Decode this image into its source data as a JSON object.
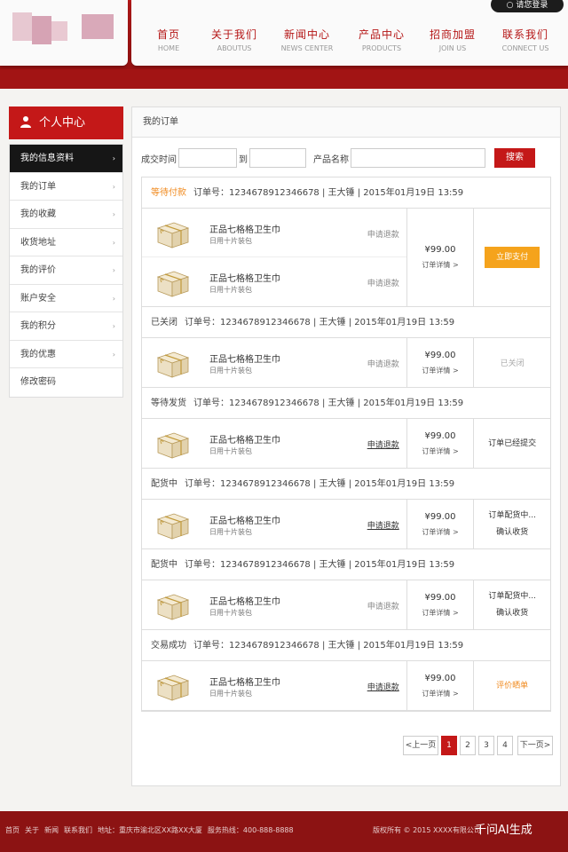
{
  "header": {
    "login_label": "○ 请您登录",
    "nav": [
      {
        "cn": "首页",
        "en": "HOME"
      },
      {
        "cn": "关于我们",
        "en": "ABOUTUS"
      },
      {
        "cn": "新闻中心",
        "en": "NEWS CENTER"
      },
      {
        "cn": "产品中心",
        "en": "PRODUCTS"
      },
      {
        "cn": "招商加盟",
        "en": "JOIN US"
      },
      {
        "cn": "联系我们",
        "en": "CONNECT US"
      }
    ]
  },
  "sidebar": {
    "title": "个人中心",
    "items": [
      {
        "label": "我的信息资料"
      },
      {
        "label": "我的订单"
      },
      {
        "label": "我的收藏"
      },
      {
        "label": "收货地址"
      },
      {
        "label": "我的评价"
      },
      {
        "label": "账户安全"
      },
      {
        "label": "我的积分"
      },
      {
        "label": "我的优惠"
      },
      {
        "label": "修改密码"
      }
    ]
  },
  "main": {
    "title": "我的订单",
    "search": {
      "date_label": "成交时间",
      "to_label": "到",
      "product_label": "产品名称",
      "button": "搜索"
    },
    "orders": [
      {
        "status": "等待付款",
        "status_orange": true,
        "info": "订单号：1234678912346678 | 王大锤 | 2015年01月19日 13:59",
        "items": [
          {
            "name": "正品七格格卫生巾",
            "spec": "日用十片装包",
            "action": "申请退款"
          },
          {
            "name": "正品七格格卫生巾",
            "spec": "日用十片装包",
            "action": "申请退款"
          }
        ],
        "price": "¥99.00",
        "detail": "订单详情 >",
        "op": {
          "type": "button",
          "text": "立即支付"
        }
      },
      {
        "status": "已关闭",
        "status_orange": false,
        "info": "订单号：1234678912346678 | 王大锤 | 2015年01月19日 13:59",
        "items": [
          {
            "name": "正品七格格卫生巾",
            "spec": "日用十片装包",
            "action": "申请退款"
          }
        ],
        "price": "¥99.00",
        "detail": "订单详情 >",
        "op": {
          "type": "muted",
          "text": "已关闭"
        }
      },
      {
        "status": "等待发货",
        "status_orange": false,
        "info": "订单号：1234678912346678 | 王大锤 | 2015年01月19日 13:59",
        "items": [
          {
            "name": "正品七格格卫生巾",
            "spec": "日用十片装包",
            "action": "申请退款"
          }
        ],
        "price": "¥99.00",
        "detail": "订单详情 >",
        "op": {
          "type": "text",
          "text": "订单已经提交"
        }
      },
      {
        "status": "配货中",
        "status_orange": false,
        "info": "订单号：1234678912346678 | 王大锤 | 2015年01月19日 13:59",
        "items": [
          {
            "name": "正品七格格卫生巾",
            "spec": "日用十片装包",
            "action": "申请退款"
          }
        ],
        "price": "¥99.00",
        "detail": "订单详情 >",
        "op": {
          "type": "two",
          "text": "订单配货中...",
          "sub": "确认收货"
        }
      },
      {
        "status": "配货中",
        "status_orange": false,
        "info": "订单号：1234678912346678 | 王大锤 | 2015年01月19日 13:59",
        "items": [
          {
            "name": "正品七格格卫生巾",
            "spec": "日用十片装包",
            "action": "申请退款"
          }
        ],
        "price": "¥99.00",
        "detail": "订单详情 >",
        "op": {
          "type": "two",
          "text": "订单配货中...",
          "sub": "确认收货"
        }
      },
      {
        "status": "交易成功",
        "status_orange": false,
        "info": "订单号：1234678912346678 | 王大锤 | 2015年01月19日 13:59",
        "items": [
          {
            "name": "正品七格格卫生巾",
            "spec": "日用十片装包",
            "action": "申请退款"
          }
        ],
        "price": "¥99.00",
        "detail": "订单详情 >",
        "op": {
          "type": "orange",
          "text": "评价晒单"
        }
      }
    ],
    "pager": {
      "prev": "<上一页",
      "pages": [
        "1",
        "2",
        "3",
        "4"
      ],
      "current": "1",
      "next": "下一页>"
    }
  },
  "footer": {
    "links": [
      "首页",
      "关于",
      "新闻",
      "联系我们",
      "地址：重庆市渝北区XX路XX大厦",
      "服务热线：400-888-8888"
    ],
    "copy": "版权所有 © 2015 XXXX有限公司",
    "watermark": "千问AI生成"
  },
  "colors": {
    "brand_red": "#c41818",
    "accent_orange": "#f5a31c"
  }
}
